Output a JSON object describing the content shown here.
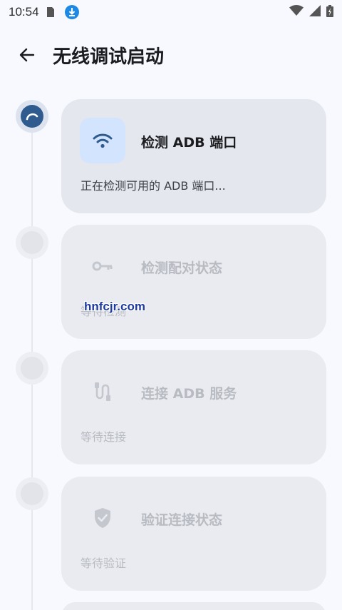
{
  "status_bar": {
    "time": "10:54",
    "icons_left": [
      "sim-card-icon",
      "download-icon"
    ],
    "icons_right": [
      "wifi-icon",
      "cell-signal-icon",
      "battery-icon"
    ]
  },
  "app_bar": {
    "back_icon": "arrow-left-icon",
    "title": "无线调试启动"
  },
  "steps": [
    {
      "state": "active",
      "icon": "wifi-icon",
      "title": "检测 ADB 端口",
      "subtitle": "正在检测可用的 ADB 端口..."
    },
    {
      "state": "pending",
      "icon": "key-icon",
      "title": "检测配对状态",
      "subtitle": "等待检测"
    },
    {
      "state": "pending",
      "icon": "usb-cable-icon",
      "title": "连接 ADB 服务",
      "subtitle": "等待连接"
    },
    {
      "state": "pending",
      "icon": "shield-check-icon",
      "title": "验证连接状态",
      "subtitle": "等待验证"
    }
  ],
  "watermark": "hnfcjr.com",
  "colors": {
    "background": "#f7f9fe",
    "card": "#e9ebf0",
    "active_dot": "#2f5b8f",
    "active_icon_bg": "#d3e4ff",
    "active_icon": "#2f5b8f",
    "pending_text": "#b8bbc2"
  }
}
